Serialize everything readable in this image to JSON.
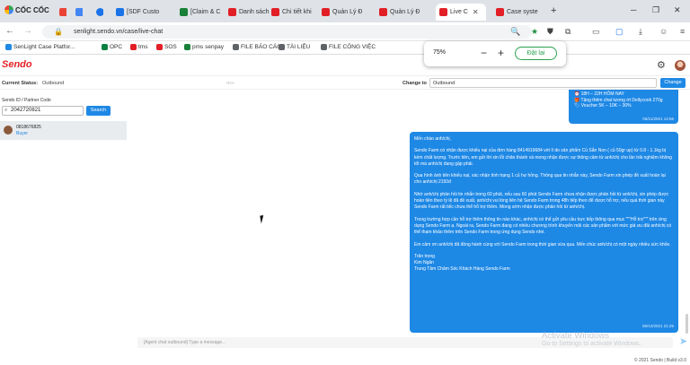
{
  "browser": {
    "brand": "CỐC CỐC",
    "tabs": [
      {
        "label": "[SDF Custo",
        "color": "#1a73e8"
      },
      {
        "label": "[Claim & C",
        "color": "#188038"
      },
      {
        "label": "Danh sách",
        "color": "#e21f26"
      },
      {
        "label": "Chi tiết khi",
        "color": "#e21f26"
      },
      {
        "label": "Quản Lý Đ",
        "color": "#e21f26"
      },
      {
        "label": "Quản Lý Đ",
        "color": "#e21f26"
      },
      {
        "label": "Live C",
        "color": "#e21f26",
        "active": true
      },
      {
        "label": "Case syste",
        "color": "#e21f26"
      }
    ],
    "url": "senlight.sendo.vn/case/live-chat",
    "bookmarks": [
      "SenLight Case Platfor...",
      "OPC",
      "tms",
      "SOS",
      "pms senpay",
      "FILE BÁO CÁO",
      "TÀI LIỆU",
      "FILE CÔNG VIỆC"
    ],
    "zoom": {
      "percent": "75%",
      "minus": "−",
      "plus": "+",
      "reset": "Đặt lại"
    }
  },
  "app": {
    "logo": "Sendo",
    "status_label": "Current Status:",
    "status_value": "Outbound",
    "status_placeholder": "-:-:-",
    "change_to_label": "Change to",
    "change_to_selected": "Outbound",
    "change_button": "Change"
  },
  "sidebar": {
    "search_label": "Sendo ID / Partner Code",
    "search_value": "2042720821",
    "search_button": "Search",
    "conversation": {
      "phone": "0818676825",
      "status": "Buyer"
    }
  },
  "chat": {
    "top_message": {
      "lines": [
        "⏰ 18H – 22H HÔM NAY",
        "🎁 Tặng thêm chai tương ớt Dellycook 270g",
        "🏷 Voucher 5K – 10K – 30%"
      ],
      "time": "05/11/2021 14:56"
    },
    "main_message": {
      "paragraphs": [
        "Mến chào anh/chị,",
        "Sendo Farm có nhận được khiếu nại của đơn hàng 8414919684 với lí do sản phẩm Củ Sắn Non ( củ 50gr up) từ 0.8 - 1.1kg bị kém chất lượng. Trước tiên, em gửi lời xin lỗi chân thành và mong nhận được sự thông cảm từ anh/chị cho lần trải nghiệm không tốt mà anh/chị đang gặp phải.",
        "Qua hình ảnh tiên khiếu nại, xác nhận tình trạng 1 củ hư hỏng. Thông qua tin nhắn này, Sendo Farm xin phép đề xuất hoàn lại cho anh/chị 2150đ",
        "Nhờ anh/chị phản hồi tin nhắn trong 60 phút, nếu sau 60 phút Sendo Farm chưa nhận được phản hồi từ anh/chị, xin phép được hoàn tiền theo tỷ lệ đã đề xuất, anh/chị vui lòng liên hệ Sendo Farm trong 48h tiếp theo để được hỗ trợ, nếu quá thời gian này Sendo Farm rất tiếc chưa thể hỗ trợ thêm. Mong sớm nhận được phản hồi từ anh/chị.",
        "Trong trường hợp cần hỗ trợ thêm thông tin nào khác, anh/chị có thể gửi yêu cầu trực tiếp thông qua mục \"\"\"Hỗ trợ\"\"\" trên ứng dụng Sendo Farm ạ. Ngoài ra, Sendo Farm đang có nhiều chương trình khuyến mãi các sản phẩm với mức giá ưu đãi anh/chị có thể tham khảo thêm trên Sendo Farm trong ứng dụng Sendo nhé.",
        "Em cảm ơn anh/chị đã đồng hành cùng với Sendo Farm trong thời gian vừa qua. Mến chúc anh/chị có một ngày nhiều sức khỏe.",
        "Trân trọng\nKim Ngân\nTrung Tâm Chăm Sóc Khách Hàng Sendo Farm"
      ],
      "time": "05/12/2021 21:25"
    },
    "composer_placeholder": "[Agent chat outbound] Type a message...",
    "watermark": {
      "line1": "Activate Windows",
      "line2": "Go to Settings to activate Windows."
    }
  },
  "footer": "© 2021 Sendo | Build v3.0"
}
